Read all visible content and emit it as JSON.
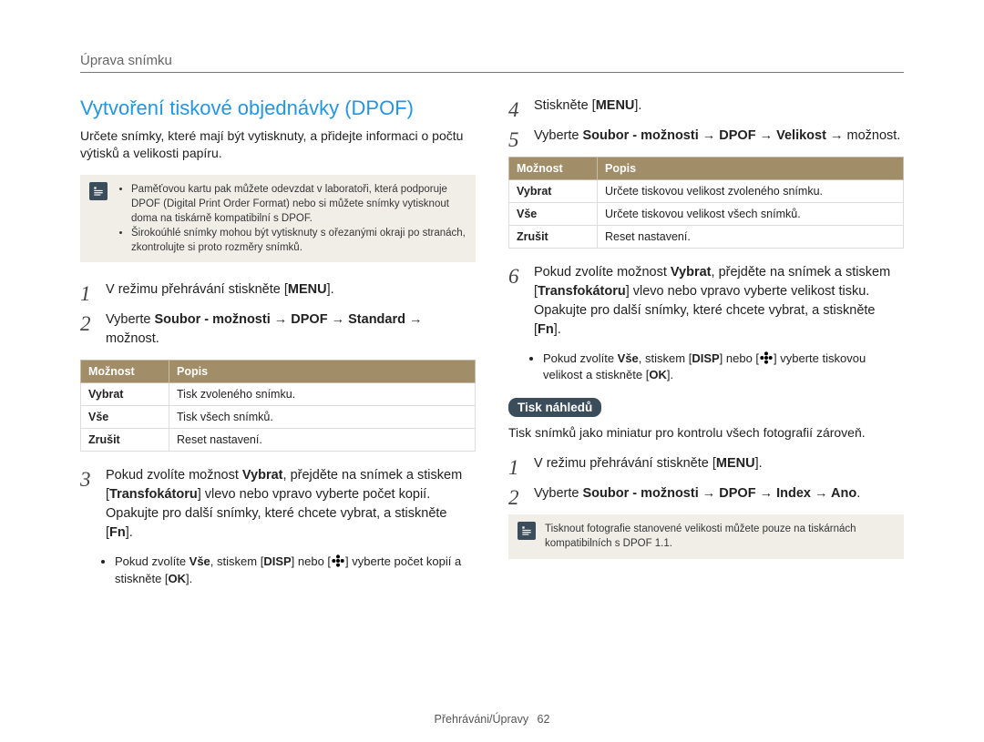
{
  "header": {
    "title": "Úprava snímku"
  },
  "left": {
    "section_title": "Vytvoření tiskové objednávky (DPOF)",
    "intro": "Určete snímky, které mají být vytisknuty, a přidejte informaci o počtu výtisků a velikosti papíru.",
    "note": {
      "bullets": [
        "Paměťovou kartu pak můžete odevzdat v laboratoři, která podporuje DPOF (Digital Print Order Format) nebo si můžete snímky vytisknout doma na tiskárně kompatibilní s DPOF.",
        "Širokoúhlé snímky mohou být vytisknuty s ořezanými okraji po stranách, zkontrolujte si proto rozměry snímků."
      ]
    },
    "steps": [
      {
        "num": "1",
        "pre": "V režimu přehrávání stiskněte [",
        "kbd": "MENU",
        "post": "]."
      },
      {
        "num": "2",
        "pre": "Vyberte ",
        "path": "Soubor - možnosti → DPOF → Standard →",
        "post": " možnost."
      }
    ],
    "table": {
      "headers": [
        "Možnost",
        "Popis"
      ],
      "rows": [
        [
          "Vybrat",
          "Tisk zvoleného snímku."
        ],
        [
          "Vše",
          "Tisk všech snímků."
        ],
        [
          "Zrušit",
          "Reset nastavení."
        ]
      ]
    },
    "step3": {
      "num": "3",
      "text_a": "Pokud zvolíte možnost ",
      "bold_a": "Vybrat",
      "text_b": ", přejděte na snímek a stiskem [",
      "bold_b": "Transfokátoru",
      "text_c": "] vlevo nebo vpravo vyberte počet kopií. Opakujte pro další snímky, které chcete vybrat, a stiskněte [",
      "kbd": "Fn",
      "text_d": "]."
    },
    "sub3": {
      "a": "Pokud zvolíte ",
      "b": "Vše",
      "c": ", stiskem [",
      "d": "DISP",
      "e": "] nebo [",
      "f": "] vyberte počet kopií a stiskněte [",
      "g": "OK",
      "h": "]."
    }
  },
  "right": {
    "step4": {
      "num": "4",
      "a": "Stiskněte [",
      "kbd": "MENU",
      "b": "]."
    },
    "step5": {
      "num": "5",
      "a": "Vyberte ",
      "path": "Soubor - možnosti → DPOF → Velikost →",
      "b": " možnost."
    },
    "table": {
      "headers": [
        "Možnost",
        "Popis"
      ],
      "rows": [
        [
          "Vybrat",
          "Určete tiskovou velikost zvoleného snímku."
        ],
        [
          "Vše",
          "Určete tiskovou velikost všech snímků."
        ],
        [
          "Zrušit",
          "Reset nastavení."
        ]
      ]
    },
    "step6": {
      "num": "6",
      "a": "Pokud zvolíte možnost ",
      "b": "Vybrat",
      "c": ", přejděte na snímek a stiskem [",
      "d": "Transfokátoru",
      "e": "] vlevo nebo vpravo vyberte velikost tisku. Opakujte pro další snímky, které chcete vybrat, a stiskněte [",
      "f": "Fn",
      "g": "]."
    },
    "sub6": {
      "a": "Pokud zvolíte ",
      "b": "Vše",
      "c": ", stiskem [",
      "d": "DISP",
      "e": "] nebo [",
      "f": "] vyberte tiskovou velikost a stiskněte [",
      "g": "OK",
      "h": "]."
    },
    "pill": "Tisk náhledů",
    "pill_sub": "Tisk snímků jako miniatur pro kontrolu všech fotografií zároveň.",
    "steps2_1": {
      "num": "1",
      "a": "V režimu přehrávání stiskněte [",
      "kbd": "MENU",
      "b": "]."
    },
    "steps2_2": {
      "num": "2",
      "a": "Vyberte ",
      "path": "Soubor - možnosti → DPOF → Index → Ano",
      "b": "."
    },
    "note2": "Tisknout fotografie stanovené velikosti můžete pouze na tiskárnách kompatibilních s DPOF 1.1."
  },
  "footer": {
    "section": "Přehráváni/Úpravy",
    "page": "62"
  }
}
